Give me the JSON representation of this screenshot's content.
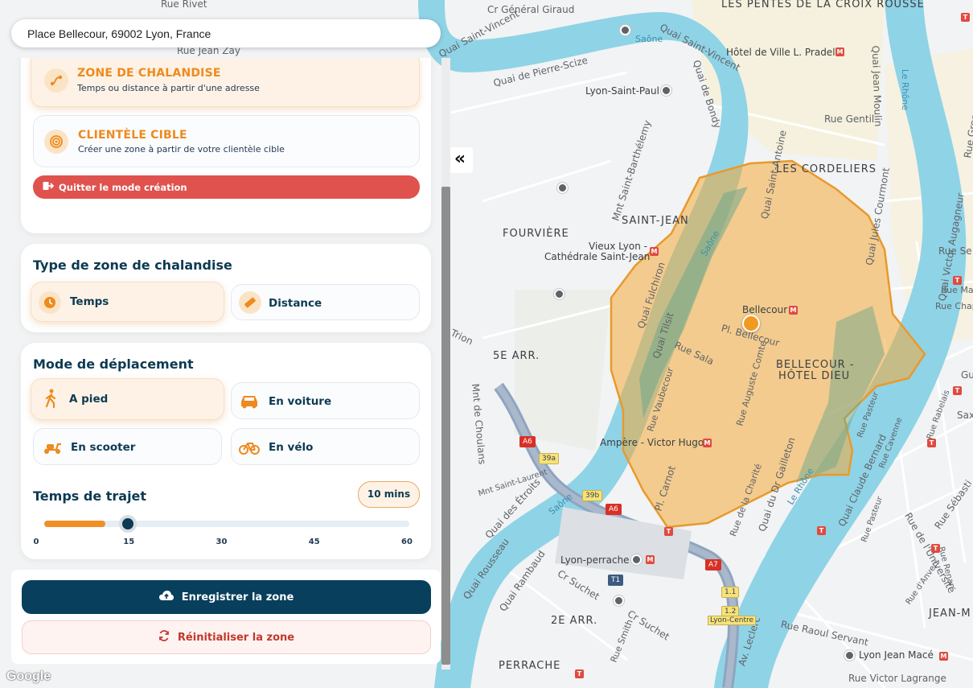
{
  "search": {
    "value": "Place Bellecour, 69002 Lyon, France"
  },
  "zone_types": [
    {
      "title": "ZONE DE CHALANDISE",
      "subtitle": "Temps ou distance à partir d'une adresse",
      "icon": "route-icon",
      "active": true
    },
    {
      "title": "CLIENTÈLE CIBLE",
      "subtitle": "Créer une zone à partir de votre clientèle cible",
      "icon": "target-icon",
      "active": false
    }
  ],
  "quit_button": {
    "label": "Quitter le mode création",
    "icon": "exit-icon"
  },
  "type_section": {
    "title": "Type de zone de chalandise",
    "options": [
      {
        "label": "Temps",
        "icon": "clock-icon",
        "active": true
      },
      {
        "label": "Distance",
        "icon": "ruler-icon",
        "active": false
      }
    ]
  },
  "mode_section": {
    "title": "Mode de déplacement",
    "options": [
      {
        "label": "A pied",
        "icon": "walk-icon",
        "active": true
      },
      {
        "label": "En voiture",
        "icon": "car-icon",
        "active": false
      },
      {
        "label": "En scooter",
        "icon": "scooter-icon",
        "active": false
      },
      {
        "label": "En vélo",
        "icon": "bike-icon",
        "active": false
      }
    ]
  },
  "travel_time": {
    "title": "Temps de trajet",
    "value_label": "10 mins",
    "value": 10,
    "min": 0,
    "max": 60,
    "ticks": [
      "0",
      "15",
      "30",
      "45",
      "60"
    ]
  },
  "footer": {
    "save_label": "Enregistrer la zone",
    "save_icon": "cloud-upload-icon",
    "reset_label": "Réinitialiser la zone",
    "reset_icon": "refresh-icon"
  },
  "collapse_button": {
    "label": "«"
  },
  "map": {
    "attribution": "Google",
    "colors": {
      "zone_fill": "#f4a93b",
      "zone_border": "#e89a2c",
      "water": "#8fd3e6",
      "park": "#6fa78a"
    },
    "labels": {
      "croix_rousse": "LES PENTES DE LA CROIX ROUSSE",
      "rue_general_giraud": "Cr Général Giraud",
      "rue_rivet": "Rue Rivet",
      "quai_saint_vincent": "Quai Saint-Vincent",
      "rue_jean_zay": "Rue Jean Zay",
      "quai_pierre_scize": "Quai de Pierre-Scize",
      "saone_north": "Saône",
      "quai_saint_vincent_2": "Quai Saint-Vincent",
      "hotel_de_ville": "Hôtel de Ville L. Pradel",
      "lyon_saint_paul": "Lyon-Saint-Paul",
      "quai_de_bondy": "Quai de Bondy",
      "rue_gentil": "Rue Gentil",
      "quai_saint_antoine": "Quai Saint-Antoine",
      "quai_jean_moulin": "Quai Jean Moulin",
      "le_rhone_north": "Le Rhône",
      "rue_grenette": "Rue Grenette",
      "les_cordeliers": "LES CORDELIERS",
      "mnt_saint_barthelemy": "Mnt Saint-Barthélemy",
      "saint_jean": "SAINT-JEAN",
      "fourviere": "FOURVIÈRE",
      "vieux_lyon": "Vieux Lyon -",
      "cathedrale": "Cathédrale Saint-Jean",
      "saone_center": "Saône",
      "quai_jules_courmont": "Quai Jules Courmont",
      "quai_fulchiron": "Quai Fulchiron",
      "bellecour_station": "Bellecour",
      "pl_bellecour": "Pl. Bellecour",
      "quai_tilsit": "Quai Tilsit",
      "rue_sala": "Rue Sala",
      "trion": "Trion",
      "cinquieme_arr": "5E ARR.",
      "bellecour_hotel_dieu_1": "BELLECOUR -",
      "bellecour_hotel_dieu_2": "HÔTEL DIEU",
      "rue_auguste_comte": "Rue Auguste Comte",
      "rue_vaubecour": "Rue Vaubecour",
      "mnt_de_choulans": "Mnt de Choulans",
      "ampere": "Ampère - Victor Hugo",
      "pont_victor_augagneur": "Quai Victor Augagneur",
      "rue_servient": "Rue Se",
      "rue_mazenod": "Rue Maz",
      "rue_chaponnay": "Rue Chap",
      "guillotiere": "Gu",
      "mnt_saint_laurent": "Mnt Saint-Laurent",
      "quai_des_etroits": "Quai des Étroits",
      "saone_south": "Saône",
      "pl_carnot": "Pl. Carnot",
      "rue_de_la_charite": "Rue de la Charité",
      "quai_dr_gailleton": "Quai du Dr Gailleton",
      "le_rhone_south": "Le Rhône",
      "quai_claude_bernard": "Quai Claude Bernard",
      "rue_de_l_universite": "Rue de l'Université",
      "rue_sebastien": "Rue Sébasti",
      "quai_rousseau": "Quai Rousseau",
      "lyon_perrache": "Lyon-perrache",
      "quai_rambaud": "Quai Rambaud",
      "cr_suchet_1": "Cr Suchet",
      "cr_suchet_2": "Cr Suchet",
      "rue_smith": "Rue Smith",
      "deuxieme_arr": "2E ARR.",
      "perrache": "PERRACHE",
      "av_leclerc": "Av. Leclerc",
      "rue_raoul_servant": "Rue Raoul Servant",
      "lyon_jean_mace": "Lyon Jean Macé",
      "rue_victor_lagrange": "Rue Victor Lagrange",
      "jean_m": "JEAN-M",
      "lyon_centre": "Lyon-Centre",
      "rue_pasteur": "Rue Pasteur",
      "rue_cavenne": "Rue Cavenne",
      "rue_pasteur_2": "Rue Pasteur",
      "rue_d_anvers": "Rue d'Anvers",
      "rue_renan": "Rue Renan",
      "rue_rabelais": "Rue Rabelais",
      "sax": "Sax"
    },
    "road_badges": {
      "a6_north": "A6",
      "a6_south": "A6",
      "r39a": "39a",
      "r39b": "39b",
      "a7": "A7",
      "r1_1": "1.1",
      "r1_2": "1.2",
      "t1": "T1"
    }
  }
}
